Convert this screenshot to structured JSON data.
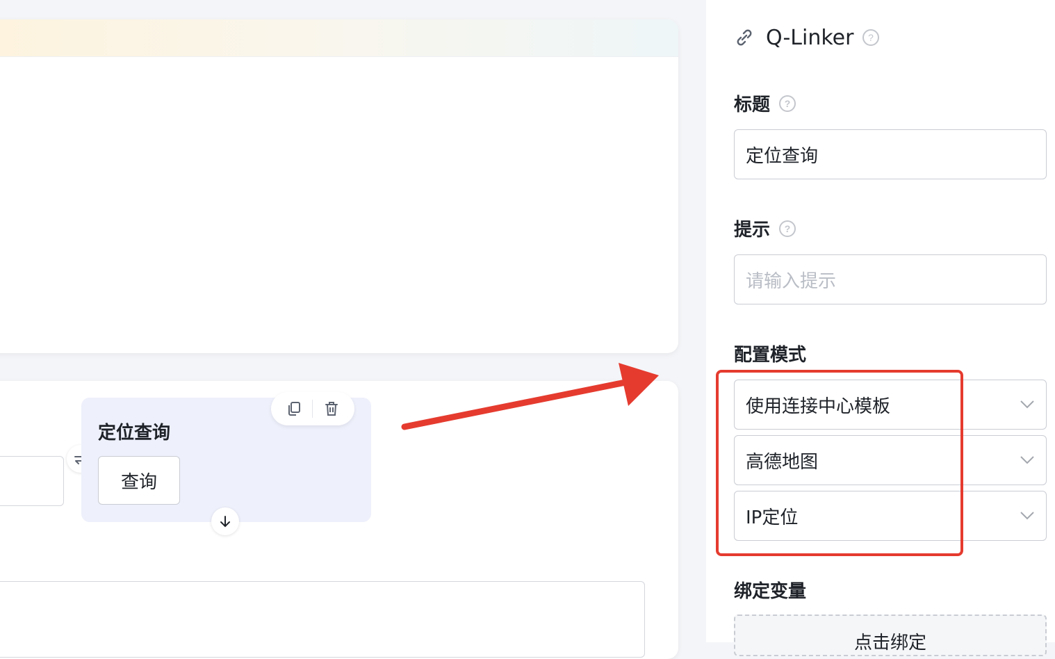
{
  "canvas": {
    "block": {
      "title": "定位查询",
      "button_label": "查询"
    }
  },
  "panel": {
    "title": "Q-Linker",
    "fields": {
      "title_label": "标题",
      "title_value": "定位查询",
      "hint_label": "提示",
      "hint_placeholder": "请输入提示",
      "config_label": "配置模式",
      "config_selects": [
        "使用连接中心模板",
        "高德地图",
        "IP定位"
      ],
      "bind_label": "绑定变量",
      "bind_button": "点击绑定"
    }
  },
  "annotation": {
    "color": "#e53b2f"
  }
}
